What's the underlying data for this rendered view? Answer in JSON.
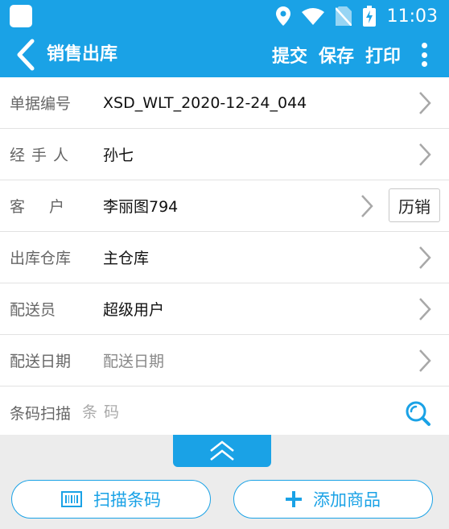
{
  "status": {
    "time": "11:03"
  },
  "app_bar": {
    "title": "销售出库",
    "actions": [
      "提交",
      "保存",
      "打印"
    ]
  },
  "form": {
    "rows": [
      {
        "label": "单据编号",
        "value": "XSD_WLT_2020-12-24_044"
      },
      {
        "label": "经手人",
        "value": "孙七"
      },
      {
        "label": "客户",
        "value": "李丽图794",
        "button": "历销"
      },
      {
        "label": "出库仓库",
        "value": "主仓库"
      },
      {
        "label": "配送员",
        "value": "超级用户"
      },
      {
        "label": "配送日期",
        "value": "配送日期"
      }
    ],
    "scan": {
      "label": "条码扫描",
      "placeholder": "条码"
    }
  },
  "bottom": {
    "scan_button": "扫描条码",
    "add_button": "添加商品"
  },
  "colors": {
    "primary": "#1aa2e6"
  }
}
